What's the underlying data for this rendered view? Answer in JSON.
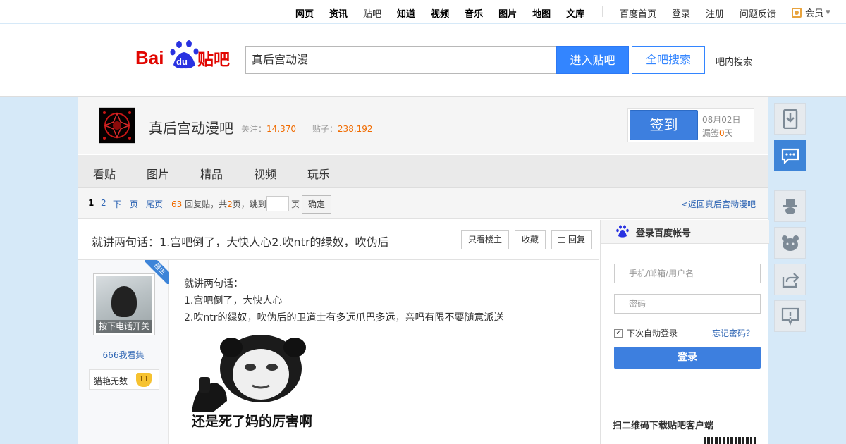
{
  "topnav": {
    "items": [
      {
        "label": "网页",
        "plain": false
      },
      {
        "label": "资讯",
        "plain": false
      },
      {
        "label": "贴吧",
        "plain": true
      },
      {
        "label": "知道",
        "plain": false
      },
      {
        "label": "视频",
        "plain": false
      },
      {
        "label": "音乐",
        "plain": false
      },
      {
        "label": "图片",
        "plain": false
      },
      {
        "label": "地图",
        "plain": false
      },
      {
        "label": "文库",
        "plain": false
      }
    ],
    "links": [
      "百度首页",
      "登录",
      "注册",
      "问题反馈"
    ],
    "member": "会员"
  },
  "header": {
    "logo_text": "Baidu贴吧",
    "search_value": "真后宫动漫",
    "enter_button": "进入贴吧",
    "all_search_button": "全吧搜索",
    "inner_search_link": "吧内搜索"
  },
  "forum": {
    "name": "真后宫动漫吧",
    "follow_label": "关注：",
    "follow_count": "14,370",
    "posts_label": "贴子：",
    "posts_count": "238,192",
    "sign_button": "签到",
    "sign_date": "08月02日",
    "missed_label": "漏签",
    "missed_count": "0",
    "missed_unit": "天"
  },
  "tabs": [
    "看贴",
    "图片",
    "精品",
    "视频",
    "玩乐"
  ],
  "pager": {
    "current": "1",
    "page2": "2",
    "next": "下一页",
    "last": "尾页",
    "reply_count": "63",
    "summary_a": "回复贴，共",
    "pages": "2",
    "summary_b": "页，跳到",
    "page_unit": "页",
    "ok_button": "确定",
    "back_link": "<返回真后宫动漫吧"
  },
  "thread": {
    "title": "就讲两句话：1.宫吧倒了，大快人心2.吹ntr的绿奴，吹伪后",
    "only_op_button": "只看楼主",
    "favorite_button": "收藏",
    "reply_button": "回复"
  },
  "post": {
    "op_badge": "楼主",
    "avatar_caption": "按下电话开关",
    "username": "666我看集",
    "badge_title": "猎艳无数",
    "badge_level": "11",
    "lines": [
      "就讲两句话：",
      "1.宫吧倒了，大快人心",
      "2.吹ntr的绿奴，吹伪后的卫道士有多远爪巴多远，亲吗有限不要随意派送"
    ],
    "meme_caption": "还是死了妈的厉害啊"
  },
  "login": {
    "title": "登录百度帐号",
    "username_placeholder": "手机/邮箱/用户名",
    "password_placeholder": "密码",
    "remember_label": "下次自动登录",
    "forgot_link": "忘记密码？",
    "login_button": "登录",
    "qr_title": "扫二维码下载贴吧客户端"
  },
  "tools": [
    "download-icon",
    "chat-icon",
    "magician-icon",
    "bear-icon",
    "share-icon",
    "report-icon"
  ],
  "colors": {
    "accent": "#3385ff",
    "sign": "#3d7fdf",
    "orange": "#f06b00",
    "page_bg": "#d6e9f8"
  }
}
